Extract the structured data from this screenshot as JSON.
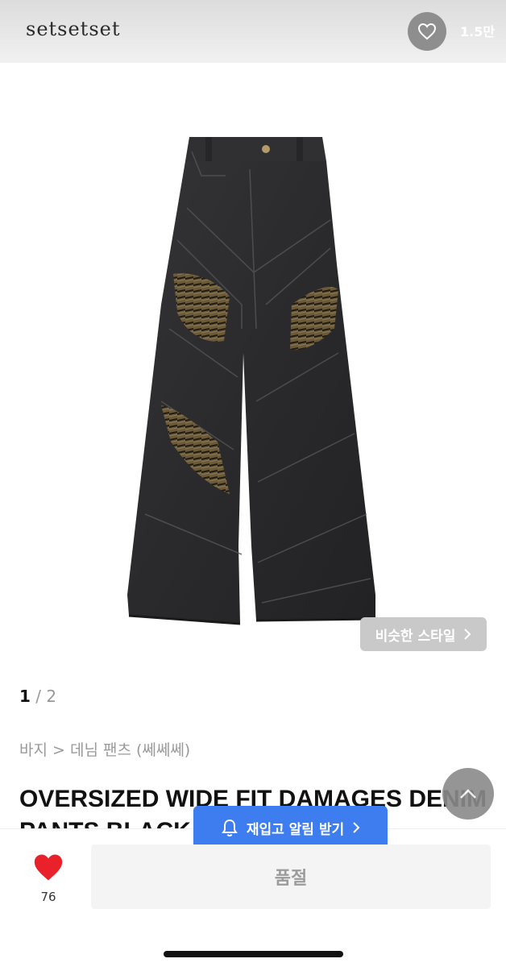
{
  "header": {
    "brand": "setsetset",
    "like_icon": "heart-outline-icon",
    "like_count": "1.5만"
  },
  "image": {
    "similar_style_label": "비슷한 스타일",
    "similar_style_icon": "chevron-right-icon"
  },
  "pager": {
    "current": "1",
    "separator": " / ",
    "total": "2"
  },
  "breadcrumb": "바지 > 데님 팬츠 (쎄쎄쎄)",
  "product": {
    "title": "OVERSIZED WIDE FIT DAMAGES DENIM PANTS BLACK"
  },
  "restock": {
    "icon": "bell-icon",
    "label": "재입고 알림 받기",
    "chevron_icon": "chevron-right-icon"
  },
  "scroll_top_icon": "chevron-up-icon",
  "bottom_bar": {
    "wish_icon": "heart-filled-icon",
    "wish_count": "76",
    "status_label": "품절"
  },
  "colors": {
    "accent_blue": "#3e7df0",
    "heart_red": "#e8212b",
    "denim": "#2b2b2d"
  }
}
